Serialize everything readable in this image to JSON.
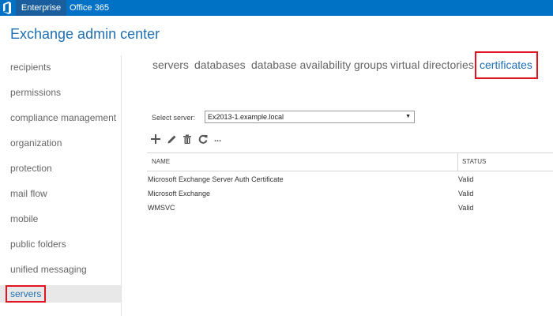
{
  "topbar": {
    "logo_icon": "office-logo-icon",
    "apps": [
      "Enterprise",
      "Office 365"
    ]
  },
  "page_title": "Exchange admin center",
  "leftnav": {
    "items": [
      "recipients",
      "permissions",
      "compliance management",
      "organization",
      "protection",
      "mail flow",
      "mobile",
      "public folders",
      "unified messaging",
      "servers"
    ],
    "selected": "servers"
  },
  "tabs": [
    "servers",
    "databases",
    "database availability groups",
    "virtual directories",
    "certificates"
  ],
  "active_tab": "certificates",
  "server_select": {
    "label": "Select server:",
    "value": "Ex2013-1.example.local"
  },
  "toolbar": {
    "icons": [
      "add-icon",
      "edit-icon",
      "delete-icon",
      "refresh-icon",
      "more-icon"
    ],
    "more_label": "..."
  },
  "table": {
    "columns": [
      "NAME",
      "STATUS"
    ],
    "rows": [
      {
        "name": "Microsoft Exchange Server Auth Certificate",
        "status": "Valid"
      },
      {
        "name": "Microsoft Exchange",
        "status": "Valid"
      },
      {
        "name": "WMSVC",
        "status": "Valid"
      }
    ]
  },
  "colors": {
    "topbar": "#0072c6",
    "accent": "#1f6fb2",
    "highlight": "#e0151f"
  }
}
